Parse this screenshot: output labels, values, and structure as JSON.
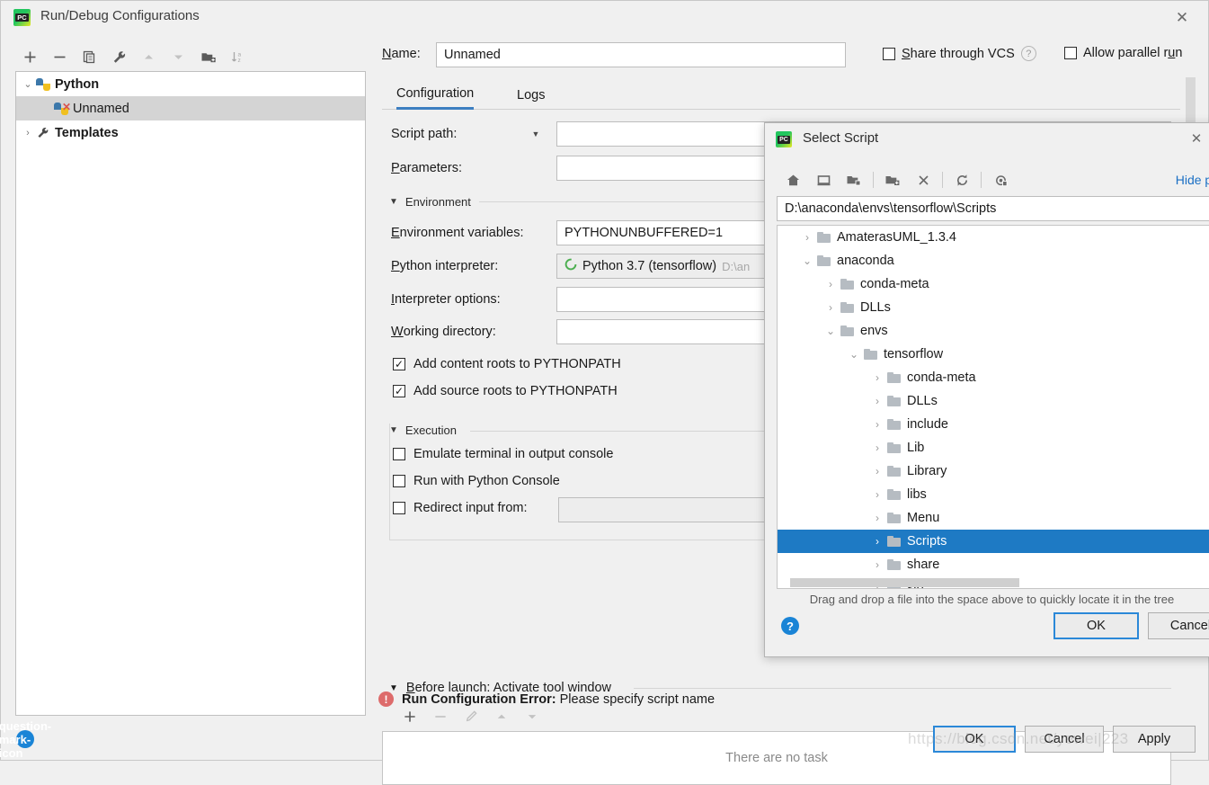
{
  "window": {
    "title": "Run/Debug Configurations",
    "app_icon": "pycharm-icon",
    "close_label": "✕"
  },
  "left_toolbar": {
    "buttons": [
      {
        "name": "add-configuration",
        "icon": "plus-icon"
      },
      {
        "name": "remove-configuration",
        "icon": "minus-icon"
      },
      {
        "name": "copy-configuration",
        "icon": "copy-icon"
      },
      {
        "name": "edit-templates",
        "icon": "wrench-icon"
      },
      {
        "name": "move-up",
        "icon": "arrow-up-icon"
      },
      {
        "name": "move-down",
        "icon": "arrow-down-icon"
      },
      {
        "name": "new-folder",
        "icon": "new-folder-icon"
      },
      {
        "name": "sort-alphabetically",
        "icon": "sort-az-icon"
      }
    ]
  },
  "config_tree": {
    "items": [
      {
        "label": "Python",
        "expanded": true,
        "bold": true,
        "selected": false,
        "indent": 0,
        "icon": "python-icon"
      },
      {
        "label": "Unnamed",
        "expanded": null,
        "bold": false,
        "selected": true,
        "indent": 1,
        "icon": "python-error-icon"
      },
      {
        "label": "Templates",
        "expanded": false,
        "bold": true,
        "selected": false,
        "indent": 0,
        "icon": "wrench-icon"
      }
    ]
  },
  "name_field": {
    "label": "Name:",
    "label_mnemonic": "N",
    "value": "Unnamed"
  },
  "top_options": {
    "share_vcs": {
      "label": "Share through VCS",
      "mnemonic": "S",
      "checked": false
    },
    "help_icon": "question-mark-icon",
    "allow_parallel": {
      "label": "Allow parallel run",
      "mnemonic": "u",
      "checked": false
    }
  },
  "tabs": [
    {
      "label": "Configuration",
      "active": true
    },
    {
      "label": "Logs",
      "active": false
    }
  ],
  "form": {
    "script_path": {
      "label": "Script path:",
      "value": "",
      "has_combo": true
    },
    "parameters": {
      "label": "Parameters:",
      "mnemonic": "P",
      "value": ""
    },
    "environment_section": "Environment",
    "env_vars": {
      "label": "Environment variables:",
      "mnemonic": "E",
      "value": "PYTHONUNBUFFERED=1"
    },
    "interpreter": {
      "label": "Python interpreter:",
      "mnemonic": "P",
      "value": "Python 3.7 (tensorflow)",
      "path_suffix": "D:\\an",
      "status_icon": "green-circle-icon"
    },
    "interpreter_options": {
      "label": "Interpreter options:",
      "mnemonic": "I",
      "value": ""
    },
    "working_dir": {
      "label": "Working directory:",
      "mnemonic": "W",
      "value": ""
    },
    "add_content_roots": {
      "label": "Add content roots to PYTHONPATH",
      "checked": true
    },
    "add_source_roots": {
      "label": "Add source roots to PYTHONPATH",
      "checked": true
    },
    "execution_section": "Execution",
    "emulate_terminal": {
      "label": "Emulate terminal in output console",
      "checked": false
    },
    "run_python_console": {
      "label": "Run with Python Console",
      "checked": false
    },
    "redirect_input": {
      "label": "Redirect input from:",
      "checked": false,
      "value": ""
    }
  },
  "before_launch": {
    "header": "Before launch: Activate tool window",
    "mnemonic": "B",
    "empty_text": "There are no task",
    "buttons": [
      {
        "name": "add-task",
        "icon": "plus-icon"
      },
      {
        "name": "remove-task",
        "icon": "minus-icon"
      },
      {
        "name": "edit-task",
        "icon": "pencil-icon"
      },
      {
        "name": "move-task-up",
        "icon": "arrow-up-icon"
      },
      {
        "name": "move-task-down",
        "icon": "arrow-down-icon"
      }
    ]
  },
  "error": {
    "icon": "error-circle-icon",
    "prefix": "Run Configuration Error:",
    "message": "Please specify script name"
  },
  "footer": {
    "help_icon": "question-mark-icon",
    "ok": "OK",
    "cancel": "Cancel",
    "apply": "Apply"
  },
  "select_script_dialog": {
    "title": "Select Script",
    "app_icon": "pycharm-icon",
    "close_label": "✕",
    "toolbar": [
      {
        "name": "home-directory",
        "icon": "home-icon"
      },
      {
        "name": "desktop-directory",
        "icon": "desktop-icon"
      },
      {
        "name": "project-directory",
        "icon": "project-folder-icon"
      },
      {
        "name": "new-folder",
        "icon": "new-folder-icon"
      },
      {
        "name": "delete",
        "icon": "close-x-icon"
      },
      {
        "name": "refresh",
        "icon": "refresh-icon"
      },
      {
        "name": "show-hidden-files",
        "icon": "hidden-files-icon"
      }
    ],
    "hide_path_label": "Hide pa",
    "path_value": "D:\\anaconda\\envs\\tensorflow\\Scripts",
    "tree": [
      {
        "label": "AmaterasUML_1.3.4",
        "indent": 1,
        "expanded": false,
        "selected": false
      },
      {
        "label": "anaconda",
        "indent": 1,
        "expanded": true,
        "selected": false
      },
      {
        "label": "conda-meta",
        "indent": 2,
        "expanded": false,
        "selected": false
      },
      {
        "label": "DLLs",
        "indent": 2,
        "expanded": false,
        "selected": false
      },
      {
        "label": "envs",
        "indent": 2,
        "expanded": true,
        "selected": false
      },
      {
        "label": "tensorflow",
        "indent": 3,
        "expanded": true,
        "selected": false
      },
      {
        "label": "conda-meta",
        "indent": 4,
        "expanded": false,
        "selected": false
      },
      {
        "label": "DLLs",
        "indent": 4,
        "expanded": false,
        "selected": false
      },
      {
        "label": "include",
        "indent": 4,
        "expanded": false,
        "selected": false
      },
      {
        "label": "Lib",
        "indent": 4,
        "expanded": false,
        "selected": false
      },
      {
        "label": "Library",
        "indent": 4,
        "expanded": false,
        "selected": false
      },
      {
        "label": "libs",
        "indent": 4,
        "expanded": false,
        "selected": false
      },
      {
        "label": "Menu",
        "indent": 4,
        "expanded": false,
        "selected": false
      },
      {
        "label": "Scripts",
        "indent": 4,
        "expanded": false,
        "selected": true
      },
      {
        "label": "share",
        "indent": 4,
        "expanded": false,
        "selected": false
      },
      {
        "label": "sip",
        "indent": 4,
        "expanded": false,
        "selected": false
      }
    ],
    "hint": "Drag and drop a file into the space above to quickly locate it in the tree",
    "help_icon": "question-mark-icon",
    "ok": "OK",
    "cancel": "Cancel"
  },
  "watermark": "https://blog.csdn.net/yewei|223",
  "colors": {
    "accent_blue": "#1e7ac4",
    "tab_underline": "#3d7fc1",
    "link_blue": "#1a6fc4",
    "error_red": "#dd6b6b",
    "selection_gray": "#d4d4d4",
    "window_bg": "#f0f0f0"
  }
}
